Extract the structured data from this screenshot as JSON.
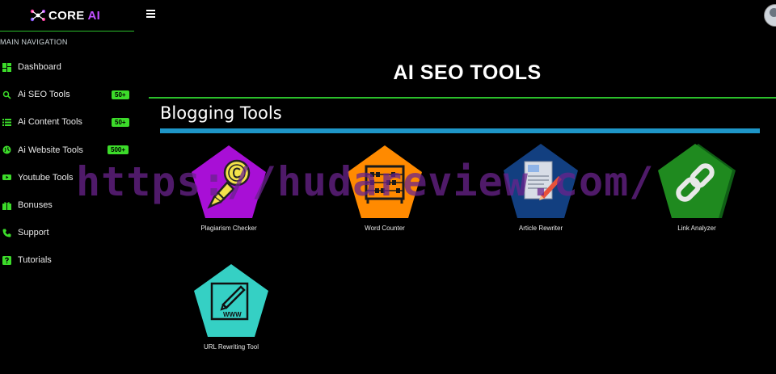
{
  "brand": {
    "name": "CORE ",
    "accent": "AI"
  },
  "sidebar": {
    "heading": "MAIN NAVIGATION",
    "items": [
      {
        "label": "Dashboard",
        "icon": "dashboard-icon",
        "badge": ""
      },
      {
        "label": "Ai SEO Tools",
        "icon": "search-icon",
        "badge": "50+"
      },
      {
        "label": "Ai Content Tools",
        "icon": "list-icon",
        "badge": "50+"
      },
      {
        "label": "Ai Website Tools",
        "icon": "globe-icon",
        "badge": "500+"
      },
      {
        "label": "Youtube Tools",
        "icon": "youtube-icon",
        "badge": ""
      },
      {
        "label": "Bonuses",
        "icon": "gift-icon",
        "badge": ""
      },
      {
        "label": "Support",
        "icon": "phone-icon",
        "badge": ""
      },
      {
        "label": "Tutorials",
        "icon": "help-icon",
        "badge": ""
      }
    ]
  },
  "main": {
    "title": "AI SEO TOOLS",
    "section_title": "Blogging Tools",
    "tools": [
      {
        "label": "Plagiarism Checker",
        "color": "#a80fd6",
        "icon": "pen-copyright-icon"
      },
      {
        "label": "Word Counter",
        "color": "#ff8a00",
        "icon": "abacus-icon"
      },
      {
        "label": "Article Rewriter",
        "color": "#123f80",
        "icon": "document-edit-icon"
      },
      {
        "label": "Link Analyzer",
        "color": "#1f8a1f",
        "icon": "chain-link-icon"
      },
      {
        "label": "URL Rewriting Tool",
        "color": "#35d0c4",
        "icon": "www-edit-icon"
      }
    ]
  },
  "watermark": "https://hudareview.com/",
  "colors": {
    "accent_green": "#2bbf2b",
    "badge_green": "#3cdb2a",
    "section_blue": "#1e96c8",
    "watermark": "#69238c"
  }
}
